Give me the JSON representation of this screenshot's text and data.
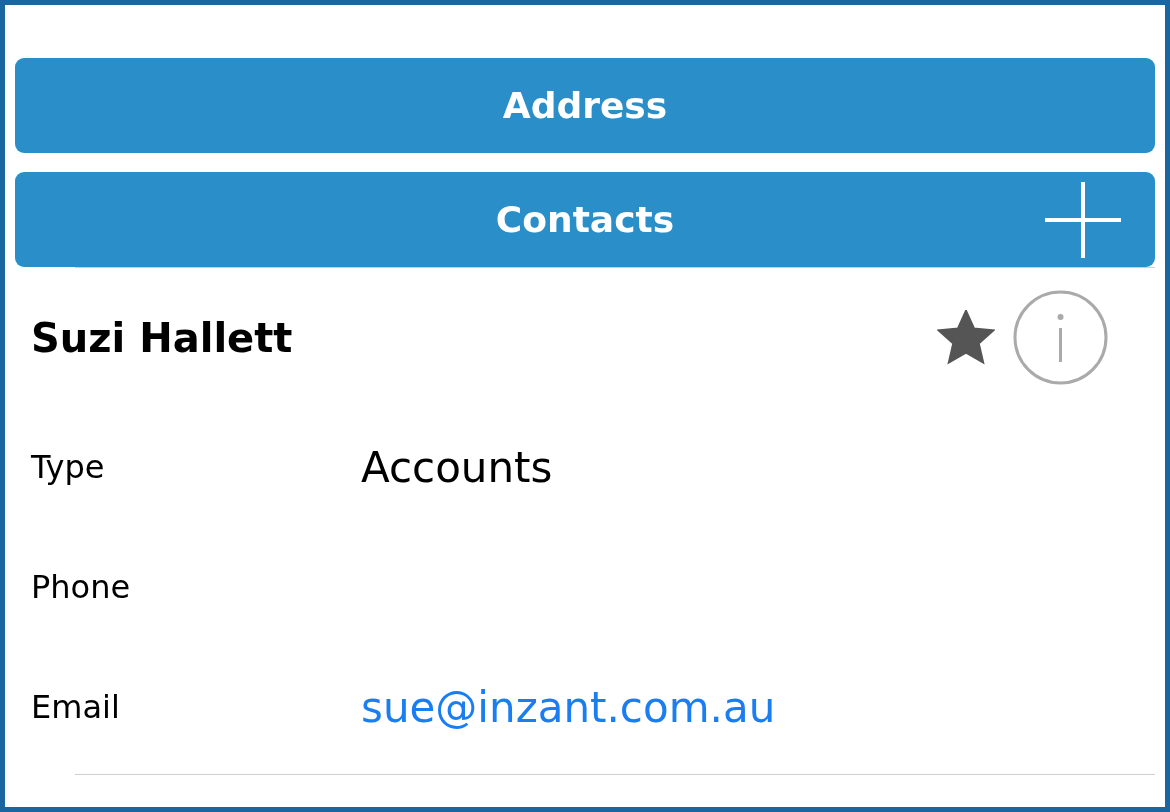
{
  "sections": [
    {
      "label": "Address",
      "kind": "plain"
    },
    {
      "label": "Contacts",
      "kind": "add"
    }
  ],
  "contact": {
    "name": "Suzi Hallett",
    "favorite": true,
    "fields": [
      {
        "label": "Type",
        "value": "Accounts",
        "kind": "text"
      },
      {
        "label": "Phone"
      },
      {
        "label": "Email",
        "value": "sue@inzant.com.au",
        "kind": "link"
      }
    ]
  }
}
